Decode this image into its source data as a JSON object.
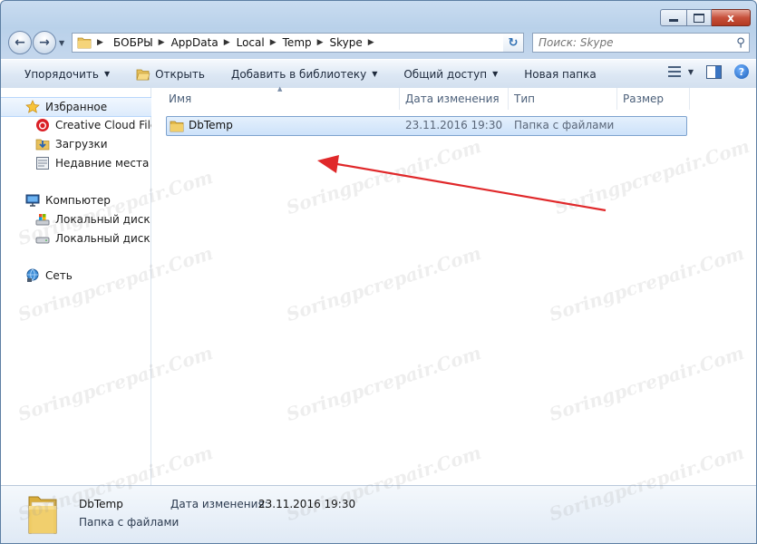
{
  "window": {
    "close_glyph": "x"
  },
  "address": {
    "crumbs": [
      "БОБРЫ",
      "AppData",
      "Local",
      "Temp",
      "Skype"
    ]
  },
  "search": {
    "placeholder": "Поиск: Skype"
  },
  "toolbar": {
    "organize": "Упорядочить",
    "open": "Открыть",
    "add_to_library": "Добавить в библиотеку",
    "share": "Общий доступ",
    "new_folder": "Новая папка"
  },
  "sidebar": {
    "items": [
      {
        "label": "Избранное",
        "icon": "star-icon"
      },
      {
        "label": "Creative Cloud Files",
        "icon": "creative-cloud-icon"
      },
      {
        "label": "Загрузки",
        "icon": "downloads-icon"
      },
      {
        "label": "Недавние места",
        "icon": "recent-places-icon"
      },
      {
        "label": "Компьютер",
        "icon": "computer-icon"
      },
      {
        "label": "Локальный диск (C",
        "icon": "drive-c-icon"
      },
      {
        "label": "Локальный диск (D",
        "icon": "drive-d-icon"
      },
      {
        "label": "Сеть",
        "icon": "network-icon"
      }
    ]
  },
  "columns": {
    "name": "Имя",
    "date": "Дата изменения",
    "type": "Тип",
    "size": "Размер"
  },
  "files": [
    {
      "name": "DbTemp",
      "date": "23.11.2016 19:30",
      "type": "Папка с файлами",
      "size": ""
    }
  ],
  "details": {
    "name": "DbTemp",
    "type": "Папка с файлами",
    "date_label": "Дата изменения:",
    "date_value": "23.11.2016 19:30"
  },
  "watermark": "Soringpcrepair.Com",
  "colors": {
    "selection_border": "#7da2ce",
    "annotation_arrow": "#e0282a"
  }
}
